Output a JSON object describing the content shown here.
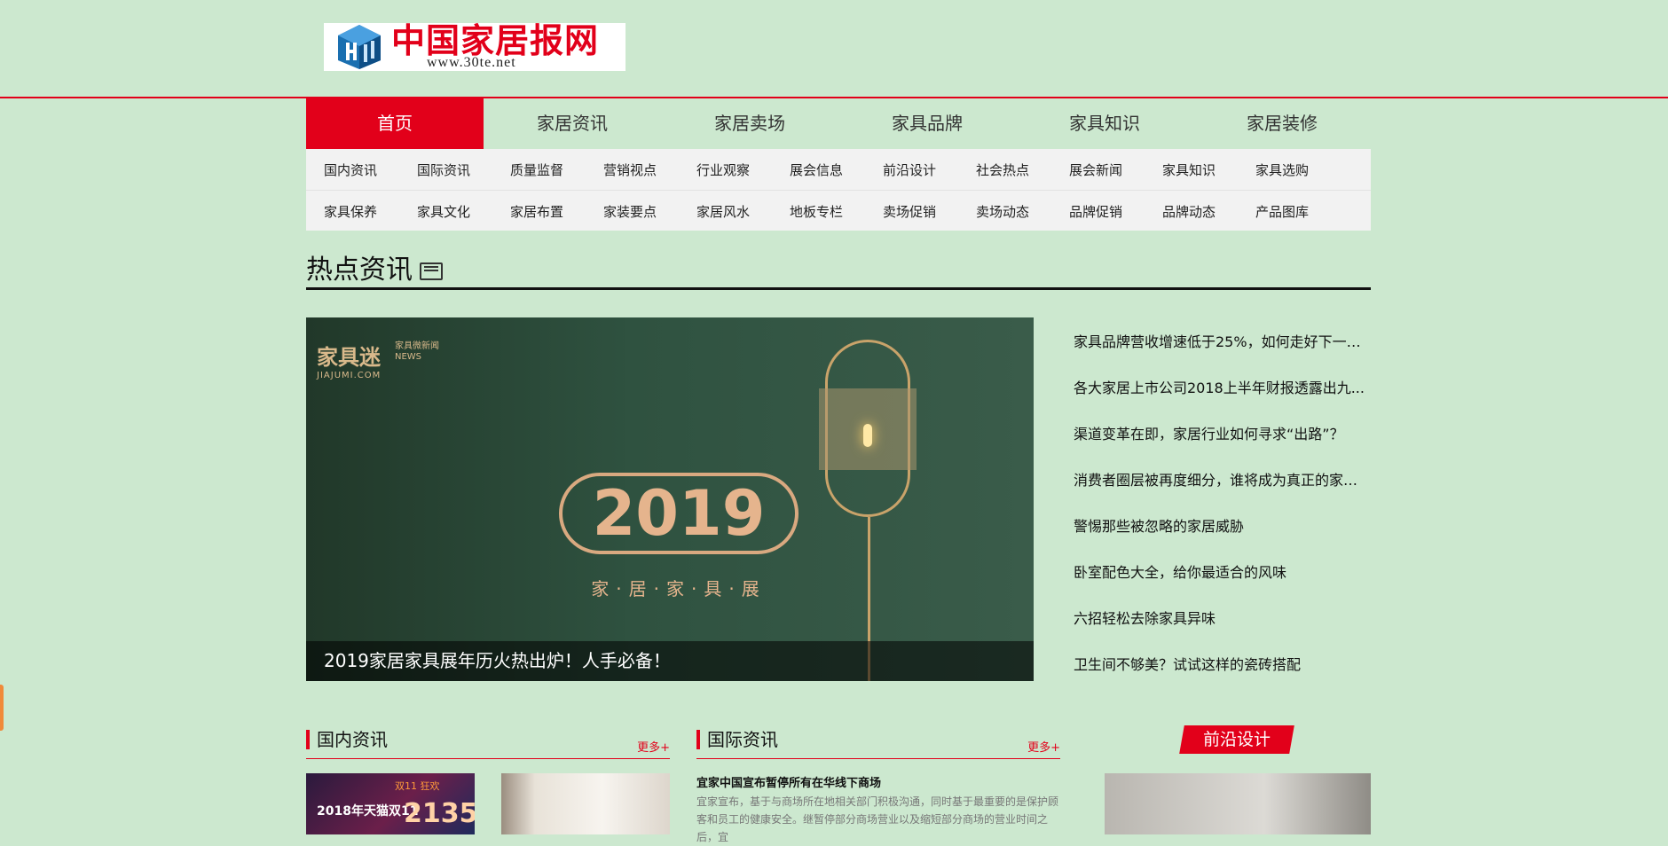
{
  "header": {
    "logo_cn": "中国家居报网",
    "logo_url": "www.30te.net"
  },
  "nav": {
    "items": [
      "首页",
      "家居资讯",
      "家居卖场",
      "家具品牌",
      "家具知识",
      "家居装修"
    ],
    "active_index": 0
  },
  "subnav": {
    "row1": [
      "国内资讯",
      "国际资讯",
      "质量监督",
      "营销视点",
      "行业观察",
      "展会信息",
      "前沿设计",
      "社会热点",
      "展会新闻",
      "家具知识",
      "家具选购"
    ],
    "row2": [
      "家具保养",
      "家具文化",
      "家居布置",
      "家装要点",
      "家居风水",
      "地板专栏",
      "卖场促销",
      "卖场动态",
      "品牌促销",
      "品牌动态",
      "产品图库"
    ]
  },
  "hot": {
    "title": "热点资讯",
    "banner": {
      "brand_main": "家具迷",
      "brand_sub": "JIAJUMI.COM",
      "brand_news": "家具微新闻 NEWS",
      "year": "2019",
      "expo": "家·居·家·具·展",
      "caption": "2019家居家具展年历火热出炉！人手必备！"
    },
    "list": [
      "家具品牌营收增速低于25%，如何走好下一步...",
      "各大家居上市公司2018上半年财报透露出九...",
      "渠道变革在即，家居行业如何寻求“出路”？",
      "消费者圈层被再度细分，谁将成为真正的家居...",
      "警惕那些被忽略的家居威胁",
      "卧室配色大全，给你最适合的风味",
      "六招轻松去除家具异味",
      "卫生间不够美？试试这样的瓷砖搭配"
    ]
  },
  "sections": {
    "domestic": {
      "title": "国内资讯",
      "more": "更多+",
      "thumb1_text": "2018年天猫双11",
      "thumb1_top": "双11 狂欢",
      "thumb1_num": "2135"
    },
    "international": {
      "title": "国际资讯",
      "more": "更多+",
      "headline": "宜家中国宣布暂停所有在华线下商场",
      "body": "宜家宣布，基于与商场所在地相关部门积极沟通，同时基于最重要的是保护顾客和员工的健康安全。继暂停部分商场营业以及缩短部分商场的营业时间之后，宜"
    },
    "design": {
      "title": "前沿设计"
    }
  },
  "colors": {
    "bg": "#cce8cf",
    "accent": "#e2001a"
  }
}
